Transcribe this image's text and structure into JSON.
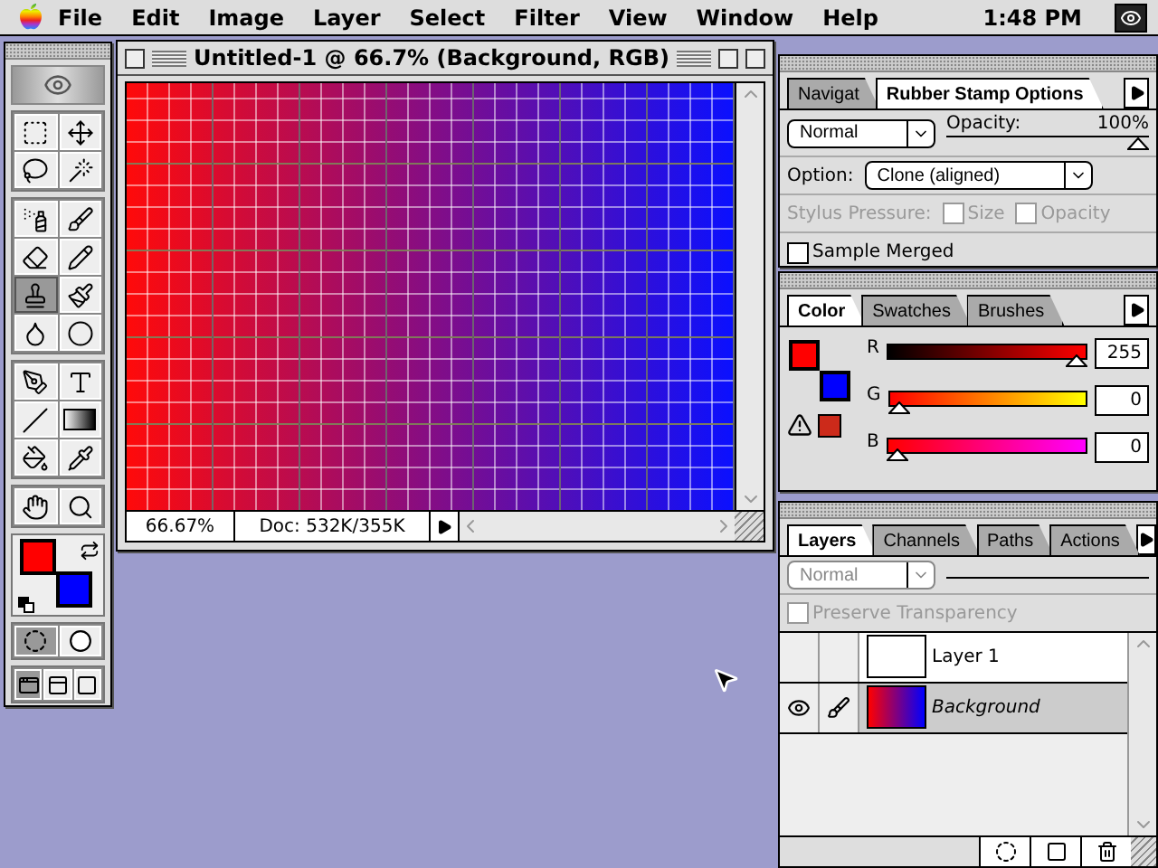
{
  "menu_bar": {
    "items": [
      "File",
      "Edit",
      "Image",
      "Layer",
      "Select",
      "Filter",
      "View",
      "Window",
      "Help"
    ],
    "clock": "1:48 PM"
  },
  "toolbox": {
    "tool_groups": [
      [
        {
          "kind": "marquee",
          "selected": false
        },
        {
          "kind": "move",
          "selected": false
        },
        {
          "kind": "lasso",
          "selected": false
        },
        {
          "kind": "wand",
          "selected": false
        }
      ],
      [
        {
          "kind": "airbrush",
          "selected": false
        },
        {
          "kind": "paintbrush",
          "selected": false
        },
        {
          "kind": "eraser",
          "selected": false
        },
        {
          "kind": "pencil",
          "selected": false
        },
        {
          "kind": "stamp",
          "selected": true
        },
        {
          "kind": "history",
          "selected": false
        },
        {
          "kind": "blur",
          "selected": false
        },
        {
          "kind": "burn",
          "selected": false
        }
      ],
      [
        {
          "kind": "pen",
          "selected": false
        },
        {
          "kind": "type",
          "selected": false
        },
        {
          "kind": "line",
          "selected": false
        },
        {
          "kind": "gradient",
          "selected": false
        },
        {
          "kind": "bucket",
          "selected": false
        },
        {
          "kind": "eyedropper",
          "selected": false
        }
      ],
      [
        {
          "kind": "hand",
          "selected": false
        },
        {
          "kind": "zoom",
          "selected": false
        }
      ]
    ],
    "swatches": [
      {
        "kind": "background",
        "color": "#0000ff"
      },
      {
        "kind": "foreground",
        "color": "#ff0000"
      }
    ],
    "mask_modes": [
      {
        "kind": "standard",
        "selected": true
      },
      {
        "kind": "quickmask",
        "selected": false
      }
    ],
    "screen_modes": [
      {
        "kind": "standard",
        "selected": true
      },
      {
        "kind": "menubar",
        "selected": false
      },
      {
        "kind": "full",
        "selected": false
      }
    ]
  },
  "document": {
    "title": "Untitled-1 @ 66.7% (Background, RGB)",
    "zoom": "66.67%",
    "doc_info": "Doc: 532K/355K"
  },
  "options_palette": {
    "tabs": [
      {
        "label": "Navigat",
        "selected": false
      },
      {
        "label": "Rubber Stamp Options",
        "selected": true
      }
    ],
    "blend_mode": "Normal",
    "opacity": {
      "label": "Opacity:",
      "value": "100%",
      "level": 1
    },
    "option_label": "Option:",
    "option_value": "Clone (aligned)",
    "stylus_label": "Stylus Pressure:",
    "stylus_options": [
      {
        "label": "Size",
        "checked": false,
        "disabled": true
      },
      {
        "label": "Opacity",
        "checked": false,
        "disabled": true
      }
    ],
    "sample_merged": {
      "label": "Sample Merged",
      "checked": false
    }
  },
  "color_palette": {
    "tabs": [
      {
        "label": "Color",
        "selected": true
      },
      {
        "label": "Swatches",
        "selected": false
      },
      {
        "label": "Brushes",
        "selected": false
      }
    ],
    "swatches": [
      {
        "kind": "background",
        "color": "#0000ff"
      },
      {
        "kind": "foreground",
        "color": "#ff0000"
      },
      {
        "kind": "gamut",
        "color": "#cc2a1a"
      }
    ],
    "channels": [
      {
        "name": "R",
        "kind": "r",
        "level": 1,
        "value": "255"
      },
      {
        "name": "G",
        "kind": "g",
        "level": 0,
        "value": "0"
      },
      {
        "name": "B",
        "kind": "b",
        "level": 0,
        "value": "0"
      }
    ]
  },
  "layers_palette": {
    "tabs": [
      {
        "label": "Layers",
        "selected": true
      },
      {
        "label": "Channels",
        "selected": false
      },
      {
        "label": "Paths",
        "selected": false
      },
      {
        "label": "Actions",
        "selected": false
      }
    ],
    "blend_mode": "Normal",
    "blend_disabled": true,
    "preserve_transparency": {
      "label": "Preserve Transparency",
      "checked": false,
      "disabled": true
    },
    "layers": [
      {
        "name": "Layer 1",
        "kind": "layer",
        "visible": false,
        "selected": false
      },
      {
        "name": "Background",
        "kind": "background",
        "visible": true,
        "selected": true
      }
    ]
  }
}
